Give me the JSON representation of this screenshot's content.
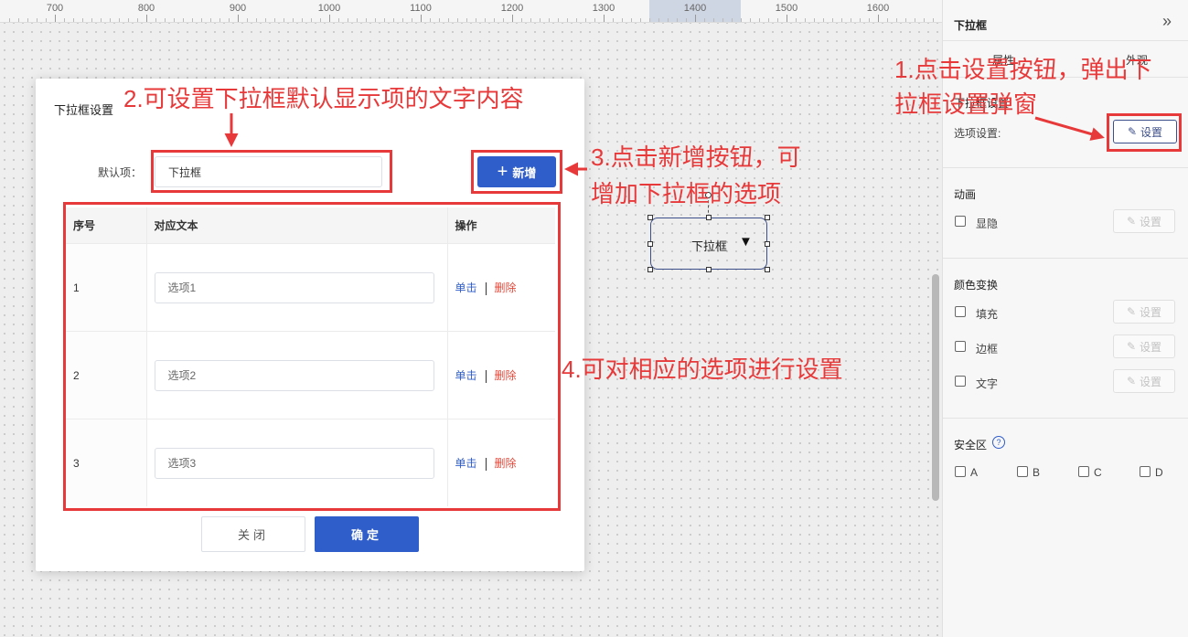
{
  "ruler": {
    "ticks": [
      "700",
      "800",
      "900",
      "1000",
      "1100",
      "1200",
      "1300",
      "1400",
      "1500",
      "1600"
    ]
  },
  "canvas": {
    "component_label": "下拉框",
    "component_arrow": "▼"
  },
  "panel": {
    "title": "下拉框",
    "collapse_icon": "»",
    "tabs": [
      "属性",
      "外观"
    ],
    "section_dropdown": "下拉框设置",
    "option_settings_label": "选项设置:",
    "setting_button": "设置",
    "animation_title": "动画",
    "animation_items": [
      "显隐"
    ],
    "color_title": "颜色变换",
    "color_items": [
      "填充",
      "边框",
      "文字"
    ],
    "safe_title": "安全区",
    "safe_help_icon": "?",
    "safe_items": [
      "A",
      "B",
      "C",
      "D"
    ]
  },
  "dialog": {
    "title": "下拉框设置",
    "default_label": "默认项：",
    "default_value": "下拉框",
    "add_button": "新增",
    "columns": [
      "序号",
      "对应文本",
      "操作"
    ],
    "rows": [
      {
        "index": "1",
        "value": "选项1",
        "action_single": "单击",
        "action_delete": "删除"
      },
      {
        "index": "2",
        "value": "选项2",
        "action_single": "单击",
        "action_delete": "删除"
      },
      {
        "index": "3",
        "value": "选项3",
        "action_single": "单击",
        "action_delete": "删除"
      }
    ],
    "close_button": "关闭",
    "ok_button": "确定"
  },
  "annotations": {
    "note1": "1.点击设置按钮，弹出下拉框设置弹窗",
    "note1_line1": "1.点击设置按钮，弹出下",
    "note1_line2": "拉框设置弹窗",
    "note2": "2.可设置下拉框默认显示项的文字内容",
    "note3_line1": "3.点击新增按钮，可",
    "note3_line2": "增加下拉框的选项",
    "note4": "4.可对相应的选项进行设置"
  },
  "colors": {
    "primary": "#2f5dc9",
    "danger": "#e2493a",
    "annotation": "#e8393a",
    "panel_accent": "#3d4f8a"
  }
}
